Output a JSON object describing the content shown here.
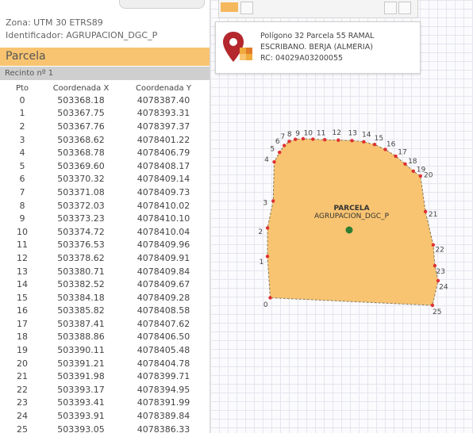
{
  "header": {
    "zone": "Zona: UTM 30 ETRS89",
    "identifier": "Identificador: AGRUPACION_DGC_P"
  },
  "parcel": {
    "title": "Parcela",
    "recinto": "Recinto nº 1"
  },
  "table": {
    "columns": [
      "Pto",
      "Coordenada X",
      "Coordenada Y"
    ],
    "rows": [
      [
        "0",
        "503368.18",
        "4078387.40"
      ],
      [
        "1",
        "503367.75",
        "4078393.31"
      ],
      [
        "2",
        "503367.76",
        "4078397.37"
      ],
      [
        "3",
        "503368.62",
        "4078401.22"
      ],
      [
        "4",
        "503368.78",
        "4078406.79"
      ],
      [
        "5",
        "503369.60",
        "4078408.17"
      ],
      [
        "6",
        "503370.32",
        "4078409.14"
      ],
      [
        "7",
        "503371.08",
        "4078409.73"
      ],
      [
        "8",
        "503372.03",
        "4078410.02"
      ],
      [
        "9",
        "503373.23",
        "4078410.10"
      ],
      [
        "10",
        "503374.72",
        "4078410.04"
      ],
      [
        "11",
        "503376.53",
        "4078409.96"
      ],
      [
        "12",
        "503378.62",
        "4078409.91"
      ],
      [
        "13",
        "503380.71",
        "4078409.84"
      ],
      [
        "14",
        "503382.52",
        "4078409.67"
      ],
      [
        "15",
        "503384.18",
        "4078409.28"
      ],
      [
        "16",
        "503385.82",
        "4078408.58"
      ],
      [
        "17",
        "503387.41",
        "4078407.62"
      ],
      [
        "18",
        "503388.86",
        "4078406.50"
      ],
      [
        "19",
        "503390.11",
        "4078405.48"
      ],
      [
        "20",
        "503391.21",
        "4078404.78"
      ],
      [
        "21",
        "503391.98",
        "4078399.71"
      ],
      [
        "22",
        "503393.17",
        "4078394.95"
      ],
      [
        "23",
        "503393.41",
        "4078391.99"
      ],
      [
        "24",
        "503393.91",
        "4078389.84"
      ],
      [
        "25",
        "503393.05",
        "4078386.33"
      ]
    ]
  },
  "info_card": {
    "line1": "Polígono 32 Parcela 55 RAMAL",
    "line2": "ESCRIBANO. BERJA (ALMERIA)",
    "line3": "RC: 04029A03200055",
    "icon": "map-pin-icon"
  },
  "map": {
    "label_title": "PARCELA",
    "label_subtitle": "AGRUPACION_DGC_P",
    "fill_color": "#f8c471",
    "vertex_color": "#e03030",
    "centroid_color": "#2e7d32"
  },
  "colors": {
    "header_accent": "#f8c471",
    "recinto_bar": "#cfcfcf",
    "pin_red": "#b3272d",
    "pin_orange": "#f0a93b"
  }
}
